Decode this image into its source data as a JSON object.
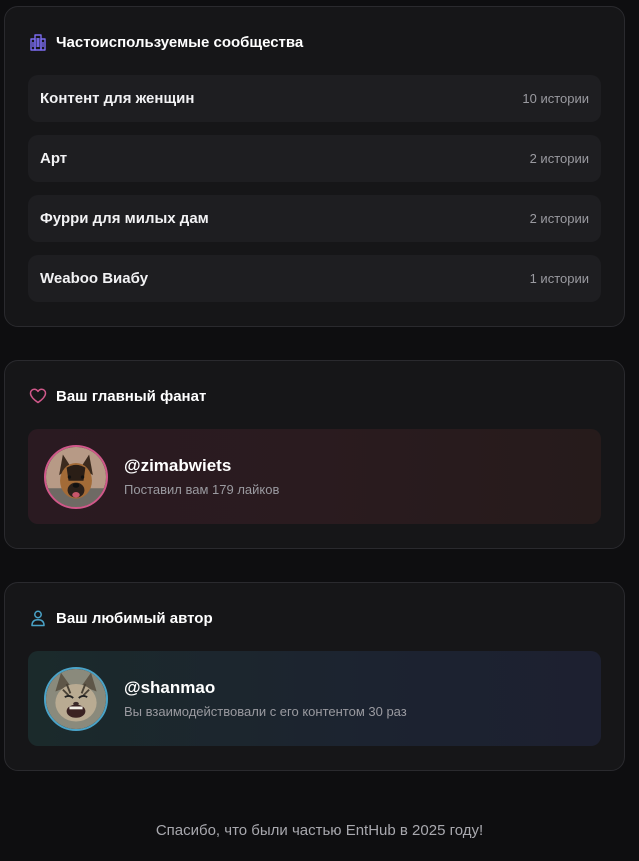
{
  "communities": {
    "title": "Частоиспользуемые сообщества",
    "icon": "building-icon",
    "items": [
      {
        "name": "Контент для женщин",
        "count": "10 истории"
      },
      {
        "name": "Арт",
        "count": "2 истории"
      },
      {
        "name": "Фурри для милых дам",
        "count": "2 истории"
      },
      {
        "name": "Weaboo Виабу",
        "count": "1 истории"
      }
    ]
  },
  "top_fan": {
    "title": "Ваш главный фанат",
    "icon": "heart-icon",
    "username": "@zimabwiets",
    "subtitle": "Поставил вам 179 лайков",
    "accent": "#d0588a"
  },
  "favorite_author": {
    "title": "Ваш любимый автор",
    "icon": "user-icon",
    "username": "@shanmao",
    "subtitle": "Вы взаимодействовали с его контентом 30 раз",
    "accent": "#4aa3c8"
  },
  "footer": {
    "text": "Спасибо, что были частью EntHub в 2025 году!"
  }
}
